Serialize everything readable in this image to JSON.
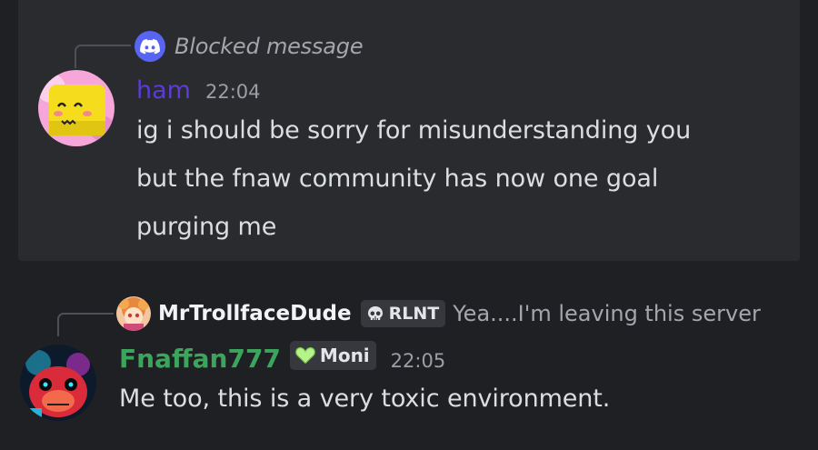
{
  "blocked": {
    "icon": "discord-logo-icon",
    "text": "Blocked message"
  },
  "message1": {
    "username": "ham",
    "username_color": "#5c3bd6",
    "timestamp": "22:04",
    "lines": [
      "ig i should be sorry for misunderstanding you",
      "but the fnaw community has now one goal",
      "purging me"
    ]
  },
  "reply": {
    "username": "MrTrollfaceDude",
    "tag": "RLNT",
    "tag_icon": "skull-icon",
    "text": "Yea....I'm leaving this server"
  },
  "message2": {
    "username": "Fnaffan777",
    "username_color": "#3ba55c",
    "tag": "Moni",
    "tag_icon": "green-heart-icon",
    "timestamp": "22:05",
    "text": "Me too, this is a very toxic environment."
  }
}
